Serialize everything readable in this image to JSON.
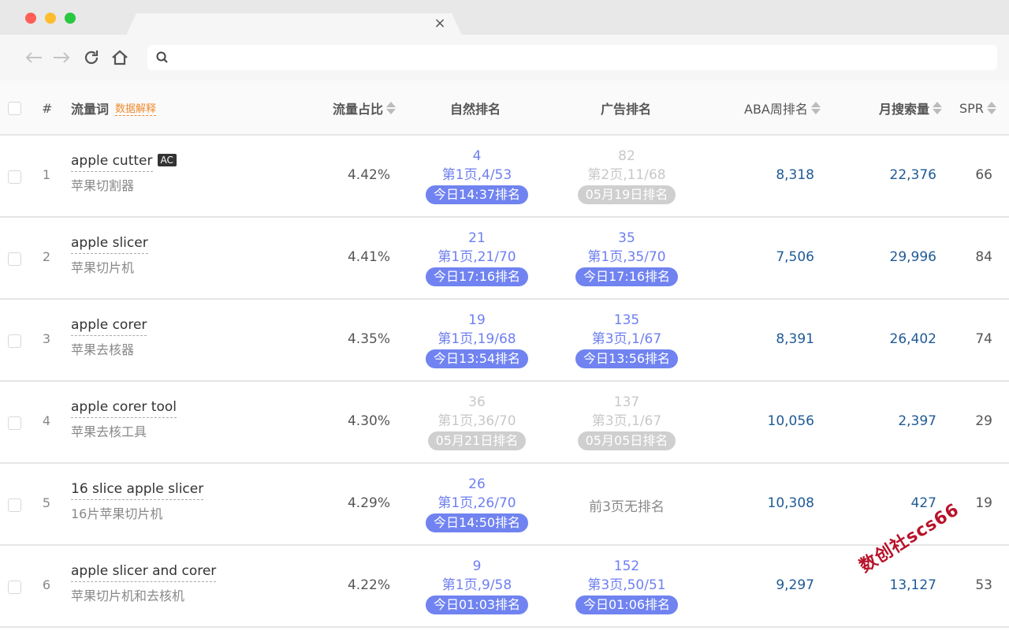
{
  "browser": {
    "tab_close": "×"
  },
  "table": {
    "headers": {
      "index": "#",
      "keyword": "流量词",
      "keyword_hint": "数据解释",
      "traffic_share": "流量占比",
      "organic_rank": "自然排名",
      "ad_rank": "广告排名",
      "aba_rank": "ABA周排名",
      "monthly_search": "月搜索量",
      "spr": "SPR"
    },
    "rows": [
      {
        "index": "1",
        "keyword_en": "apple cutter",
        "tag": "AC",
        "keyword_cn": "苹果切割器",
        "share": "4.42%",
        "organic": {
          "num": "4",
          "page": "第1页,4/53",
          "badge": "今日14:37排名",
          "state": "active"
        },
        "ad": {
          "num": "82",
          "page": "第2页,11/68",
          "badge": "05月19日排名",
          "state": "stale"
        },
        "aba": "8,318",
        "monthly": "22,376",
        "spr": "66"
      },
      {
        "index": "2",
        "keyword_en": "apple slicer",
        "keyword_cn": "苹果切片机",
        "share": "4.41%",
        "organic": {
          "num": "21",
          "page": "第1页,21/70",
          "badge": "今日17:16排名",
          "state": "active"
        },
        "ad": {
          "num": "35",
          "page": "第1页,35/70",
          "badge": "今日17:16排名",
          "state": "active"
        },
        "aba": "7,506",
        "monthly": "29,996",
        "spr": "84"
      },
      {
        "index": "3",
        "keyword_en": "apple corer",
        "keyword_cn": "苹果去核器",
        "share": "4.35%",
        "organic": {
          "num": "19",
          "page": "第1页,19/68",
          "badge": "今日13:54排名",
          "state": "active"
        },
        "ad": {
          "num": "135",
          "page": "第3页,1/67",
          "badge": "今日13:56排名",
          "state": "active"
        },
        "aba": "8,391",
        "monthly": "26,402",
        "spr": "74"
      },
      {
        "index": "4",
        "keyword_en": "apple corer tool",
        "keyword_cn": "苹果去核工具",
        "share": "4.30%",
        "organic": {
          "num": "36",
          "page": "第1页,36/70",
          "badge": "05月21日排名",
          "state": "stale"
        },
        "ad": {
          "num": "137",
          "page": "第3页,1/67",
          "badge": "05月05日排名",
          "state": "stale"
        },
        "aba": "10,056",
        "monthly": "2,397",
        "spr": "29"
      },
      {
        "index": "5",
        "keyword_en": "16 slice apple slicer",
        "keyword_cn": "16片苹果切片机",
        "share": "4.29%",
        "organic": {
          "num": "26",
          "page": "第1页,26/70",
          "badge": "今日14:50排名",
          "state": "active"
        },
        "ad": {
          "none": "前3页无排名"
        },
        "aba": "10,308",
        "monthly": "427",
        "spr": "19"
      },
      {
        "index": "6",
        "keyword_en": "apple slicer and corer",
        "keyword_cn": "苹果切片机和去核机",
        "share": "4.22%",
        "organic": {
          "num": "9",
          "page": "第1页,9/58",
          "badge": "今日01:03排名",
          "state": "active"
        },
        "ad": {
          "num": "152",
          "page": "第3页,50/51",
          "badge": "今日01:06排名",
          "state": "active"
        },
        "aba": "9,297",
        "monthly": "13,127",
        "spr": "53"
      }
    ]
  },
  "watermark": "数创社scs66",
  "colors": {
    "accent": "#7083f0",
    "stale": "#cfcfcf",
    "link_number": "#1f5a96",
    "hint": "#f08c2e"
  }
}
